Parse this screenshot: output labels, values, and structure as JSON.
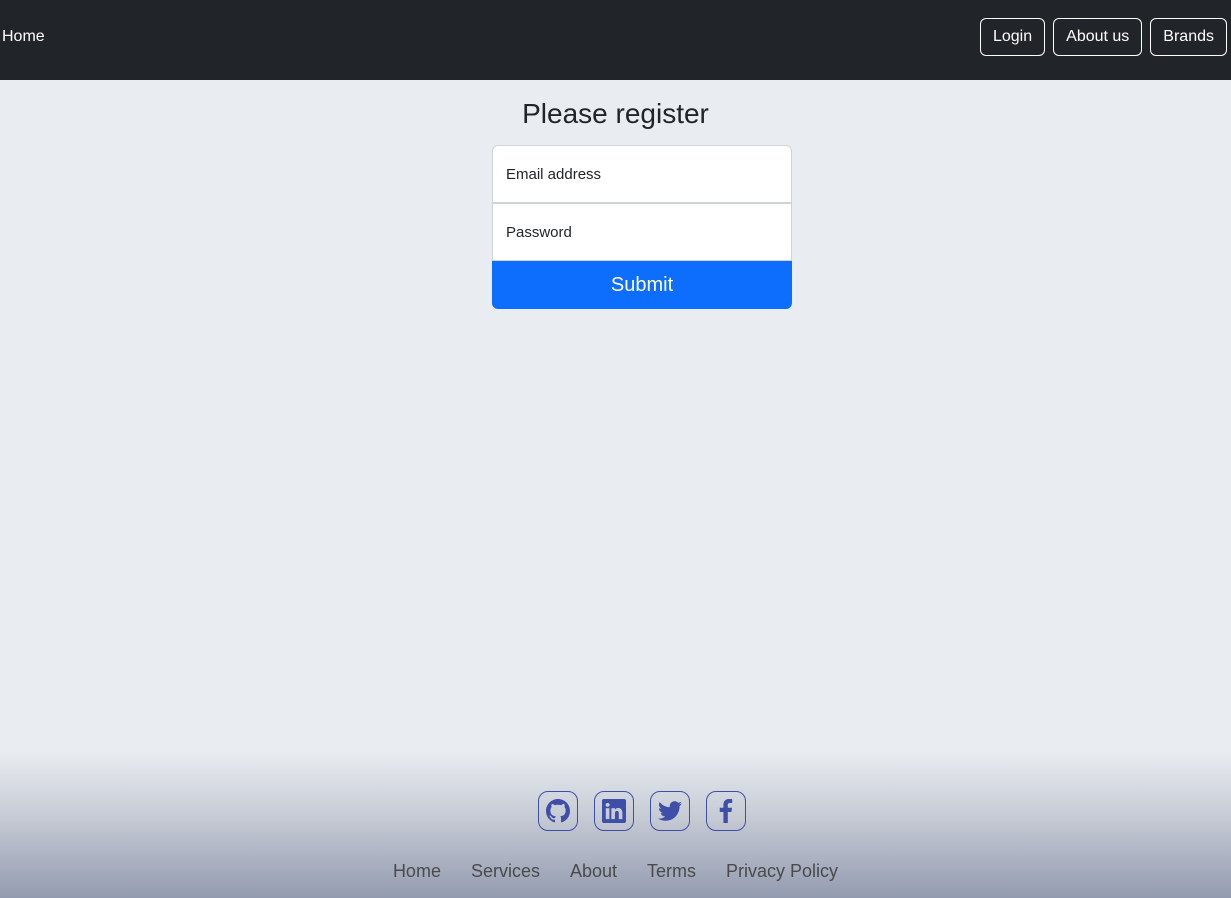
{
  "navbar": {
    "home_label": "Home",
    "buttons": [
      {
        "label": "Login"
      },
      {
        "label": "About us"
      },
      {
        "label": "Brands"
      }
    ]
  },
  "main": {
    "title": "Please register",
    "email_placeholder": "Email address",
    "password_placeholder": "Password",
    "submit_label": "Submit"
  },
  "footer": {
    "socials": [
      {
        "icon": "github-icon"
      },
      {
        "icon": "linkedin-icon"
      },
      {
        "icon": "twitter-icon"
      },
      {
        "icon": "facebook-icon"
      }
    ],
    "links": [
      {
        "label": "Home"
      },
      {
        "label": "Services"
      },
      {
        "label": "About"
      },
      {
        "label": "Terms"
      },
      {
        "label": "Privacy Policy"
      }
    ]
  },
  "colors": {
    "navbar_bg": "#212529",
    "page_bg": "#e9edf1",
    "primary": "#0d6efd",
    "icon": "#3f4fa8"
  }
}
